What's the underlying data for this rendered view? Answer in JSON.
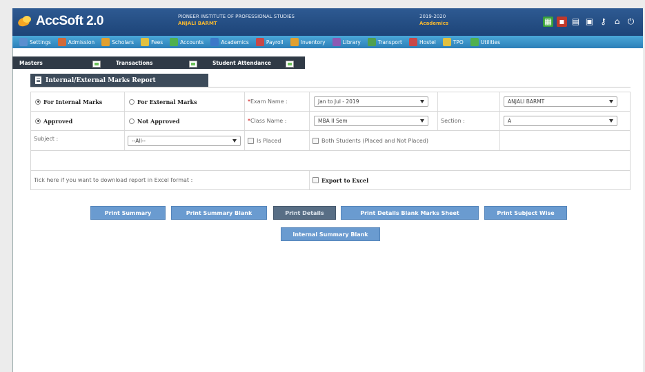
{
  "app": {
    "title": "AccSoft 2.0"
  },
  "header": {
    "institute": "PIONEER INSTITUTE OF PROFESSIONAL STUDIES",
    "user": "ANJALI BARMT",
    "year": "2019-2020",
    "year_label": "Academics",
    "icons": [
      "grid-icon",
      "folder-icon",
      "document-icon",
      "document-icon",
      "key-icon",
      "home-icon",
      "power-icon"
    ]
  },
  "menu": [
    {
      "label": "Settings",
      "icon": "gear-icon",
      "color": "#5a8fd0"
    },
    {
      "label": "Admission",
      "icon": "admission-icon",
      "color": "#d06a3a"
    },
    {
      "label": "Scholars",
      "icon": "scholars-icon",
      "color": "#e0a030"
    },
    {
      "label": "Fees",
      "icon": "fees-icon",
      "color": "#e0c040"
    },
    {
      "label": "Accounts",
      "icon": "accounts-icon",
      "color": "#4fb04f"
    },
    {
      "label": "Academics",
      "icon": "academics-icon",
      "color": "#3c78c8"
    },
    {
      "label": "Payroll",
      "icon": "payroll-icon",
      "color": "#c84848"
    },
    {
      "label": "Inventory",
      "icon": "inventory-icon",
      "color": "#e0a030"
    },
    {
      "label": "Library",
      "icon": "library-icon",
      "color": "#8c5ab4"
    },
    {
      "label": "Transport",
      "icon": "transport-icon",
      "color": "#50a050"
    },
    {
      "label": "Hostel",
      "icon": "hostel-icon",
      "color": "#c84848"
    },
    {
      "label": "TPO",
      "icon": "tpo-icon",
      "color": "#e0c040"
    },
    {
      "label": "Utilities",
      "icon": "utilities-icon",
      "color": "#4fb04f"
    }
  ],
  "submenu": [
    "Masters",
    "Transactions",
    "Student Attendance"
  ],
  "panel": {
    "title": "Internal/External Marks Report"
  },
  "form": {
    "for_internal": "For Internal Marks",
    "for_external": "For External Marks",
    "exam_name_label": "Exam Name :",
    "exam_name_value": "Jan to Jul - 2019",
    "faculty_value": "ANJALI BARMT",
    "approved": "Approved",
    "not_approved": "Not Approved",
    "class_name_label": "Class Name :",
    "class_name_value": "MBA II Sem",
    "section_label": "Section :",
    "section_value": "A",
    "subject_label": "Subject :",
    "subject_value": "--All--",
    "is_placed": "Is Placed",
    "both_students": "Both Students (Placed and Not Placed)",
    "excel_hint": "Tick here if you want to download report in Excel format :",
    "export_excel": "Export to Excel"
  },
  "buttons": {
    "print_summary": "Print Summary",
    "print_summary_blank": "Print Summary Blank",
    "print_details": "Print Details",
    "print_details_blank": "Print Details Blank Marks Sheet",
    "print_subject_wise": "Print Subject Wise",
    "internal_summary_blank": "Internal Summary Blank"
  }
}
